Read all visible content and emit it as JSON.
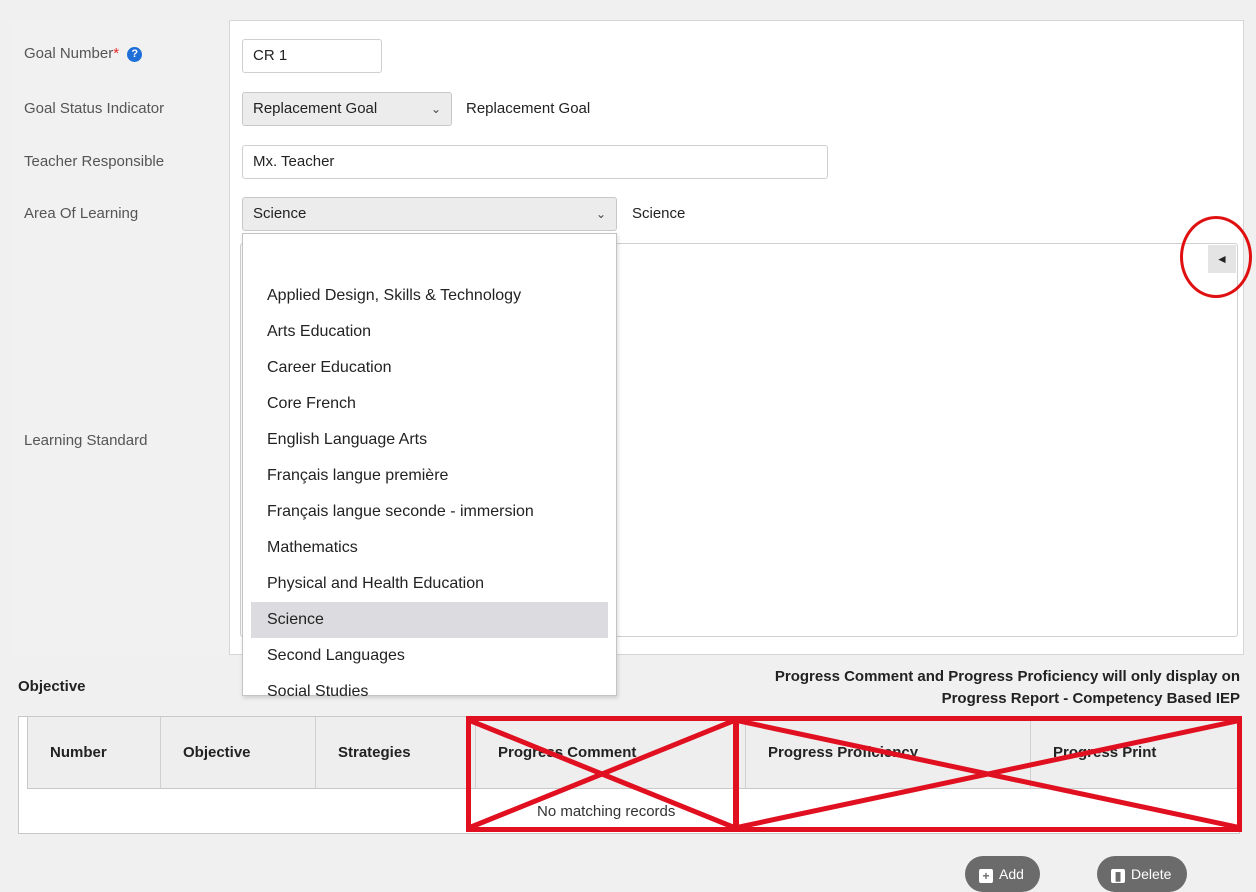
{
  "form": {
    "goal_number": {
      "label": "Goal Number",
      "required_mark": "*",
      "value": "CR 1"
    },
    "goal_status": {
      "label": "Goal Status Indicator",
      "selected": "Replacement Goal",
      "display": "Replacement Goal"
    },
    "teacher": {
      "label": "Teacher Responsible",
      "value": "Mx. Teacher"
    },
    "area": {
      "label": "Area Of Learning",
      "selected": "Science",
      "display": "Science"
    },
    "learning_standard": {
      "label": "Learning Standard"
    }
  },
  "dropdown": {
    "items": [
      "",
      "Applied Design, Skills & Technology",
      "Arts Education",
      "Career Education",
      "Core French",
      "English Language Arts",
      "Français langue première",
      "Français langue seconde - immersion",
      "Mathematics",
      "Physical and Health Education",
      "Science",
      "Second Languages",
      "Social Studies"
    ],
    "selected_index": 10
  },
  "objective": {
    "title": "Objective",
    "note_line1": "Progress Comment and Progress Proficiency will only display on",
    "note_line2": "Progress Report - Competency Based IEP",
    "columns": [
      "Number",
      "Objective",
      "Strategies",
      "Progress Comment",
      "Progress Proficiency",
      "Progress Print"
    ],
    "empty_text": "No matching records"
  },
  "buttons": {
    "add": "Add",
    "delete": "Delete"
  },
  "icons": {
    "help": "?",
    "collapse": "◄",
    "chevron": "⌄"
  },
  "colors": {
    "annotation": "#e01020",
    "help_icon": "#1e6fd8"
  }
}
